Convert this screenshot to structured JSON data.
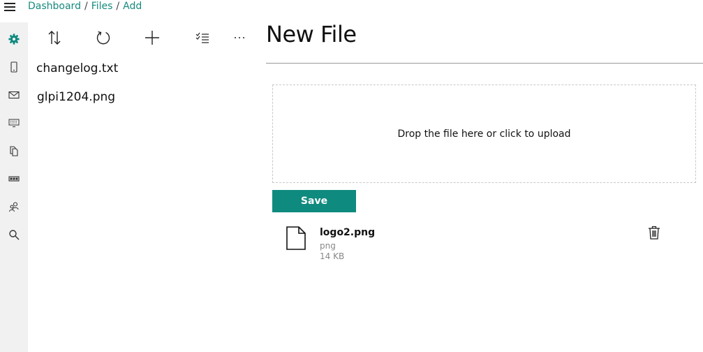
{
  "breadcrumb": {
    "items": [
      "Dashboard",
      "Files",
      "Add"
    ],
    "separator": "/"
  },
  "sidebar": {
    "items": [
      {
        "name": "settings-icon",
        "active": true
      },
      {
        "name": "phone-icon"
      },
      {
        "name": "mail-icon"
      },
      {
        "name": "keyboard-icon"
      },
      {
        "name": "files-icon"
      },
      {
        "name": "network-device-icon"
      },
      {
        "name": "users-icon"
      },
      {
        "name": "search-icon"
      }
    ]
  },
  "toolbar": {
    "icons": [
      "sort-icon",
      "refresh-icon",
      "add-icon",
      "select-list-icon",
      "more-icon"
    ]
  },
  "files": [
    "changelog.txt",
    "glpi1204.png"
  ],
  "page": {
    "title": "New File"
  },
  "dropzone": {
    "text": "Drop the file here or click to upload"
  },
  "save_label": "Save",
  "upload": {
    "name": "logo2.png",
    "type": "png",
    "size": "14 KB"
  },
  "colors": {
    "accent": "#0f8a7f",
    "link": "#168a7f",
    "sidebar_bg": "#f1f1f1"
  }
}
